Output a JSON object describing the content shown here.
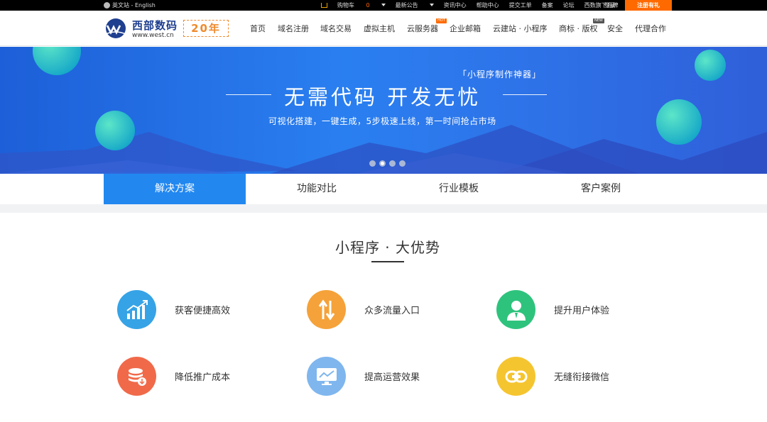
{
  "topbar": {
    "lang": "英文站 - English",
    "cart": "购物车",
    "cart_count": "0",
    "notice": "最新公告",
    "news": "资讯中心",
    "help": "帮助中心",
    "ticket": "提交工单",
    "record": "备案",
    "forum": "论坛",
    "brands": "西数旗下品牌",
    "login": "登录",
    "register": "注册有礼"
  },
  "header": {
    "brand": "西部数码",
    "url": "www.west.cn",
    "anniversary": "20年",
    "nav": [
      "首页",
      "域名注册",
      "域名交易",
      "虚拟主机",
      "云服务器",
      "企业邮箱",
      "云建站 · 小程序",
      "商标 · 版权",
      "安全",
      "代理合作"
    ],
    "hot_tag": "HOT",
    "new_tag": "NEW"
  },
  "banner": {
    "subtitle": "「小程序制作神器」",
    "title": "无需代码  开发无忧",
    "desc": "可视化搭建，一键生成，5步极速上线，第一时间抢占市场",
    "slides": 4,
    "active_slide": 2
  },
  "tabs": [
    "解决方案",
    "功能对比",
    "行业模板",
    "客户案例"
  ],
  "section": {
    "title": "小程序 · 大优势",
    "features": [
      {
        "label": "获客便捷高效",
        "icon": "growth-chart-icon",
        "color": "#36a3e6"
      },
      {
        "label": "众多流量入口",
        "icon": "traffic-arrows-icon",
        "color": "#f5a23a"
      },
      {
        "label": "提升用户体验",
        "icon": "user-icon",
        "color": "#2ec37d"
      },
      {
        "label": "降低推广成本",
        "icon": "coin-stack-icon",
        "color": "#f06a4a"
      },
      {
        "label": "提高运营效果",
        "icon": "monitor-chart-icon",
        "color": "#7fb6ee"
      },
      {
        "label": "无缝衔接微信",
        "icon": "link-icon",
        "color": "#f5c530"
      }
    ]
  }
}
